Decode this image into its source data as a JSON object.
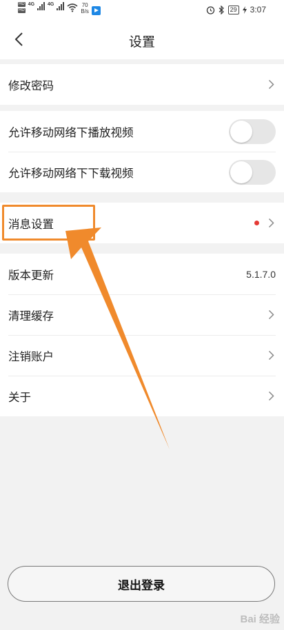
{
  "status_bar": {
    "network_1": "4G",
    "network_2": "4G",
    "speed_value": "70",
    "speed_unit": "B/s",
    "battery": "29",
    "time": "3:07"
  },
  "header": {
    "title": "设置"
  },
  "settings": {
    "change_password": "修改密码",
    "allow_mobile_play": "允许移动网络下播放视频",
    "allow_mobile_download": "允许移动网络下下载视频",
    "message_settings": "消息设置",
    "version_update": "版本更新",
    "version_value": "5.1.7.0",
    "clear_cache": "清理缓存",
    "cancel_account": "注销账户",
    "about": "关于"
  },
  "toggles": {
    "allow_mobile_play_on": false,
    "allow_mobile_download_on": false
  },
  "logout_button": "退出登录",
  "watermark": "Bai 经验",
  "colors": {
    "highlight": "#f08a2c",
    "notification_dot": "#e53935",
    "background": "#f2f2f2"
  },
  "icons": {
    "back": "chevron-left-icon",
    "row_arrow": "chevron-right-icon",
    "alarm": "alarm-icon",
    "bluetooth": "bluetooth-icon",
    "wifi": "wifi-icon"
  }
}
